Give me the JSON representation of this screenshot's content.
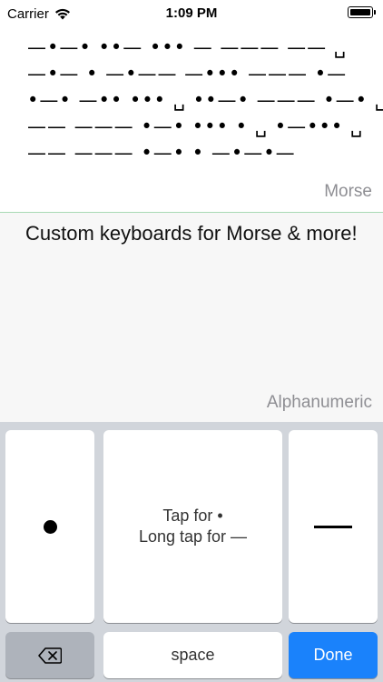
{
  "status_bar": {
    "carrier": "Carrier",
    "time": "1:09 PM"
  },
  "morse": {
    "lines": [
      "—•—• ••— ••• — ——— —— ␣",
      "—•— • —•—— —••• ——— •—",
      "•—• —•• ••• ␣ ••—• ——— •—• ␣",
      "—— ——— •—• ••• • ␣ •—••• ␣",
      "—— ——— •—• • —•—•—"
    ],
    "label": "Morse"
  },
  "alphanumeric": {
    "text": "Custom keyboards for Morse & more!",
    "label": "Alphanumeric"
  },
  "keyboard": {
    "hint_line1": "Tap for •",
    "hint_line2": "Long tap for —",
    "space_label": "space",
    "done_label": "Done",
    "backspace_glyph": "⌫"
  },
  "colors": {
    "done_blue": "#1a82fb",
    "keyboard_bg": "#d1d5db",
    "divider_green": "#a8d9b4"
  }
}
